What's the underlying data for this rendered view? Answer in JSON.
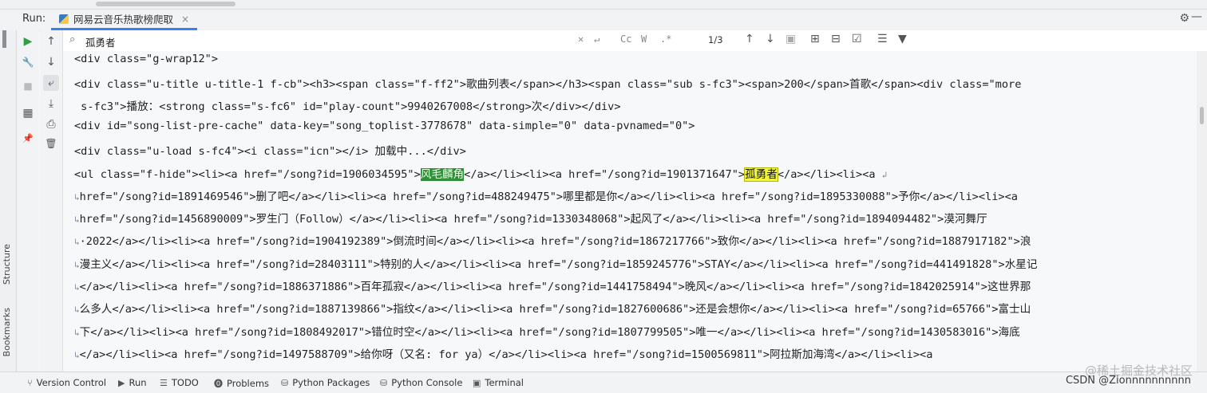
{
  "run_panel": {
    "label": "Run:",
    "tab_title": "网易云音乐热歌榜爬取",
    "close_glyph": "×",
    "settings_glyph": "⚙",
    "minimize_glyph": "—"
  },
  "left_sidebar": {
    "structure_label": "Structure",
    "bookmarks_label": "Bookmarks"
  },
  "toolbar_icons": {
    "run": "▶",
    "wrench": "🔧",
    "stop": "■",
    "layout": "▦",
    "pin": "📌",
    "up": "↑",
    "down": "↓",
    "soft_wrap": "⤶",
    "scroll_end": "⤓",
    "print": "⎙",
    "trash": "🗑"
  },
  "search": {
    "query": "孤勇者",
    "match_count": "1/3",
    "options": [
      "Cc",
      "W",
      ".*"
    ]
  },
  "code_lines": [
    "<div class=\"g-wrap12\">",
    "<div class=\"u-title u-title-1 f-cb\"><h3><span class=\"f-ff2\">歌曲列表</span></h3><span class=\"sub s-fc3\"><span>200</span>首歌</span><div class=\"more",
    " s-fc3\">播放：<strong class=\"s-fc6\" id=\"play-count\">9940267008</strong>次</div></div>",
    "<div id=\"song-list-pre-cache\" data-key=\"song_toplist-3778678\" data-simple=\"0\" data-pvnamed=\"0\">",
    "<div class=\"u-load s-fc4\"><i class=\"icn\"></i> 加载中...</div>",
    "href=\"/song?id=1891469546\">删了吧</a></li><li><a href=\"/song?id=488249475\">哪里都是你</a></li><li><a href=\"/song?id=1895330088\">予你</a></li><li><a",
    "href=\"/song?id=1456890009\">罗生门（Follow）</a></li><li><a href=\"/song?id=1330348068\">起风了</a></li><li><a href=\"/song?id=1894094482\">漠河舞厅",
    "·2022</a></li><li><a href=\"/song?id=1904192389\">倒流时间</a></li><li><a href=\"/song?id=1867217766\">致你</a></li><li><a href=\"/song?id=1887917182\">浪",
    "漫主义</a></li><li><a href=\"/song?id=28403111\">特别的人</a></li><li><a href=\"/song?id=1859245776\">STAY</a></li><li><a href=\"/song?id=441491828\">水星记",
    "</a></li><li><a href=\"/song?id=1886371886\">百年孤寂</a></li><li><a href=\"/song?id=1441758494\">晚风</a></li><li><a href=\"/song?id=1842025914\">这世界那",
    "么多人</a></li><li><a href=\"/song?id=1887139866\">指纹</a></li><li><a href=\"/song?id=1827600686\">还是会想你</a></li><li><a href=\"/song?id=65766\">富士山",
    "下</a></li><li><a href=\"/song?id=1808492017\">错位时空</a></li><li><a href=\"/song?id=1807799505\">唯一</a></li><li><a href=\"/song?id=1430583016\">海底",
    "</a></li><li><a href=\"/song?id=1497588709\">给你呀（又名: for ya）</a></li><li><a href=\"/song?id=1500569811\">阿拉斯加海湾</a></li><li><a"
  ],
  "ul_line": {
    "part1": "<ul class=\"f-hide\"><li><a href=\"/song?id=1906034595\">",
    "green_match": "风毛麟角",
    "part2": "</a></li><li><a href=\"/song?id=1901371647\">",
    "yellow_match": "孤勇者",
    "part3": "</a></li><li><a"
  },
  "status_tabs": [
    "Version Control",
    "Run",
    "TODO",
    "Problems",
    "Python Packages",
    "Python Console",
    "Terminal"
  ],
  "status_tab_icons": [
    "⑂",
    "▶",
    "☰",
    "⓿",
    "⛁",
    "⛁",
    "▣"
  ],
  "watermark": {
    "line1": "@稀土掘金技术社区",
    "line2": "CSDN @Zionnnnnnnnnn"
  }
}
